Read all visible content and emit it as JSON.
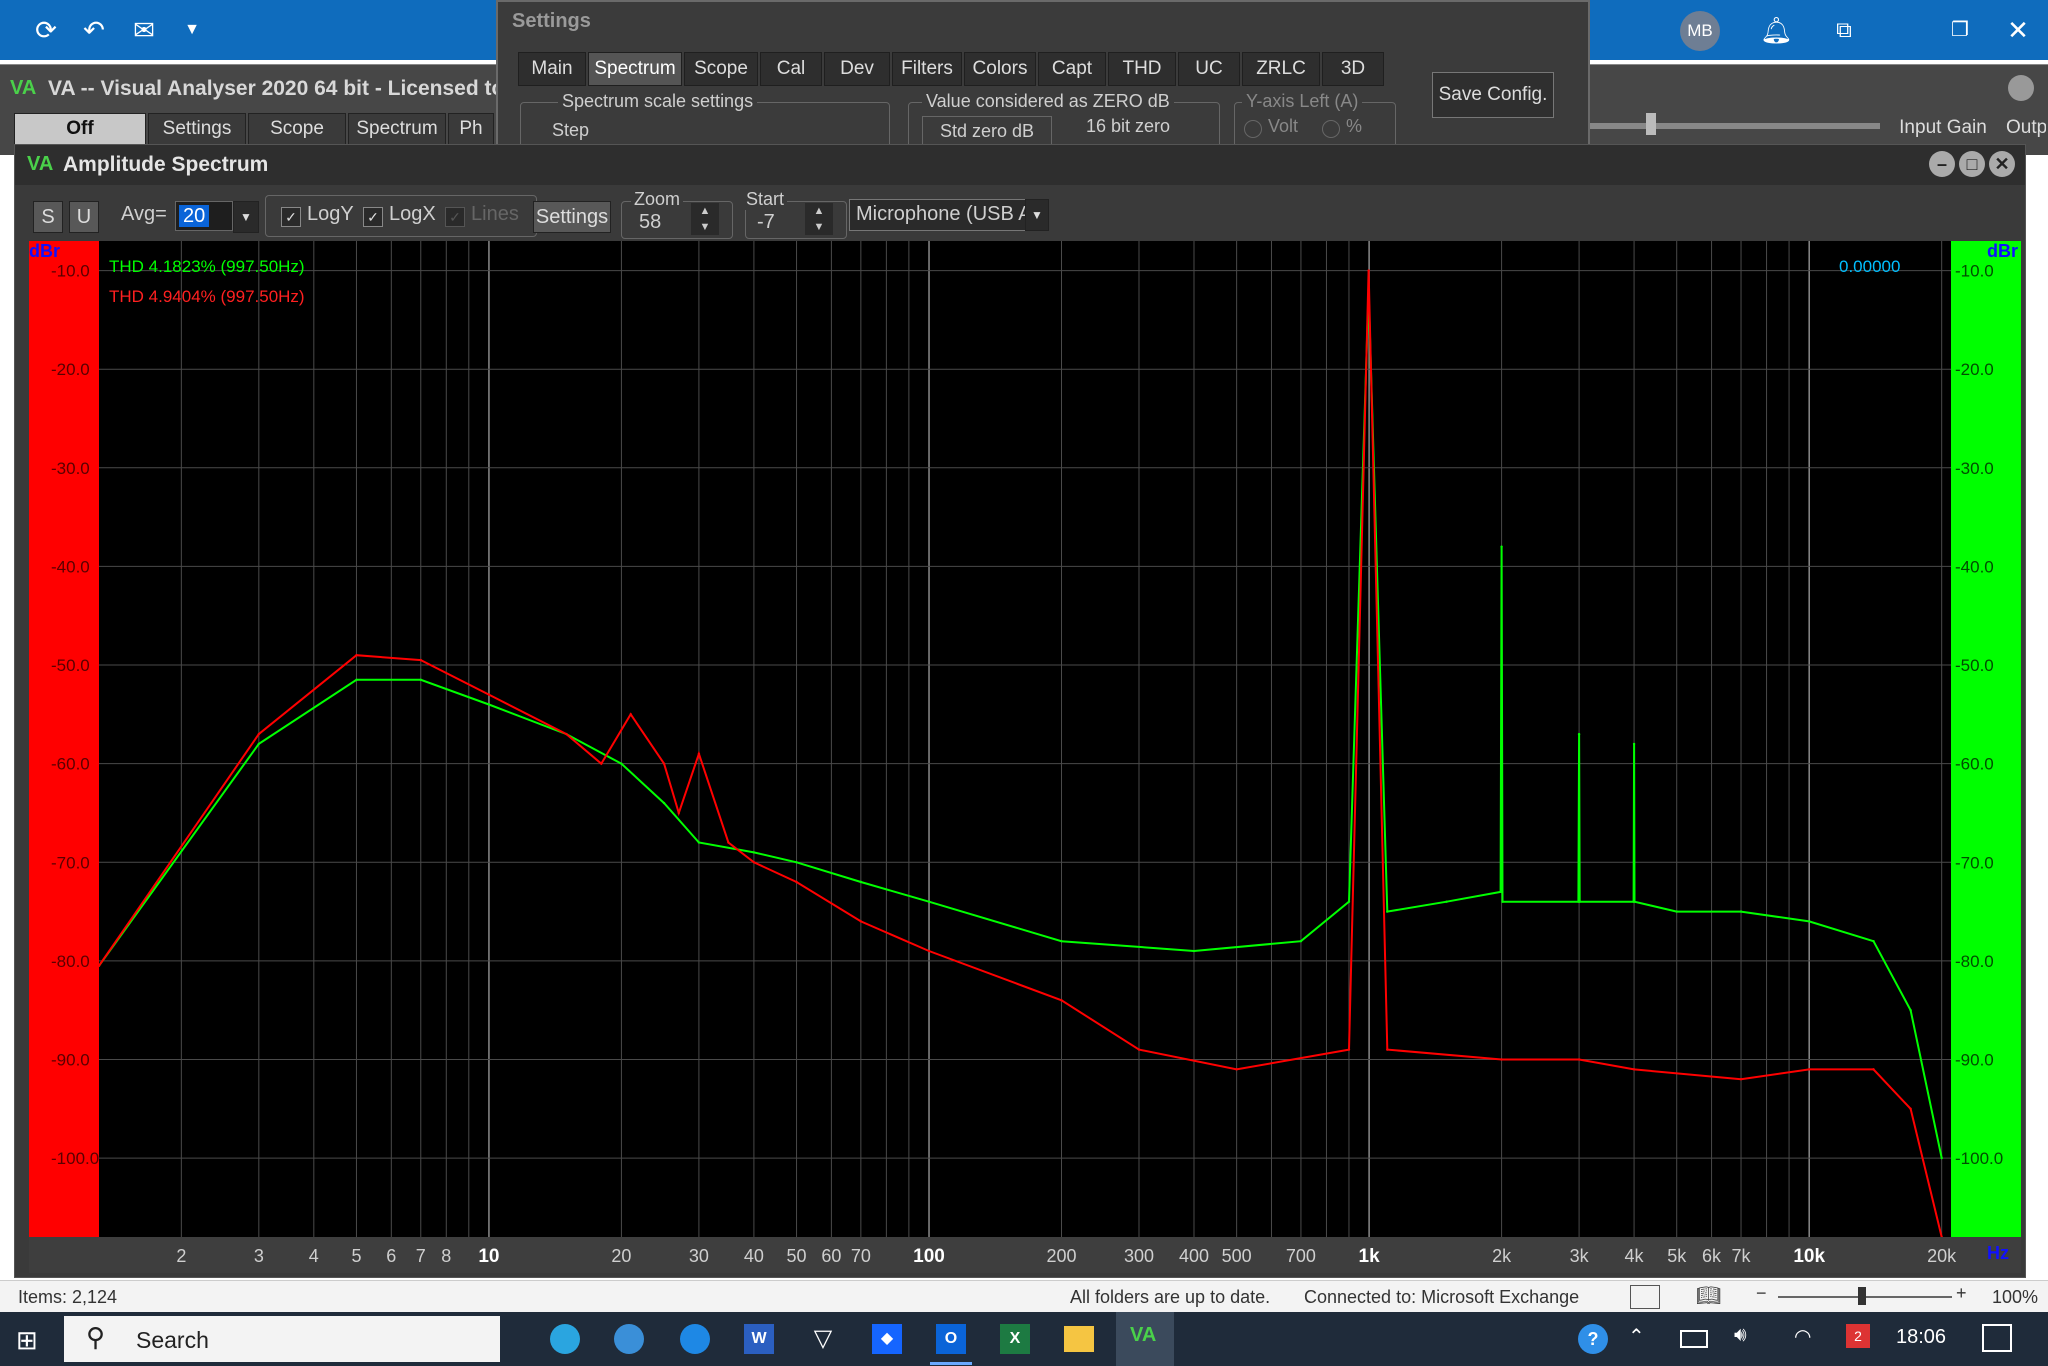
{
  "outlook": {
    "avatar": "MB",
    "icons": [
      "sync-icon",
      "undo-icon",
      "mail-icon",
      "chevron-down-icon",
      "bell-icon",
      "display-icon",
      "restore-icon",
      "close-icon"
    ]
  },
  "va_main": {
    "logo": "VA",
    "title": "VA -- Visual Analyser 2020 64 bit - Licensed to:",
    "buttons": [
      "Off",
      "Settings",
      "Scope",
      "Spectrum",
      "Ph"
    ],
    "right_label": "Input Gain",
    "right_label2": "Outp"
  },
  "settings": {
    "title": "Settings",
    "tabs": [
      "Main",
      "Spectrum",
      "Scope",
      "Cal",
      "Dev",
      "Filters",
      "Colors",
      "Capt",
      "THD",
      "UC",
      "ZRLC",
      "3D"
    ],
    "active_tab": "Spectrum",
    "group1_label": "Spectrum scale settings",
    "group1_item": "Step",
    "group2_label": "Value considered as ZERO dB",
    "group2_btn": "Std zero dB",
    "group2_value": "16 bit zero",
    "group3_label": "Y-axis Left (A)",
    "group3_opt1": "Volt",
    "group3_opt2": "%",
    "save_config": "Save Config."
  },
  "spectrum_window": {
    "logo": "VA",
    "title": "Amplitude Spectrum",
    "toolbar": {
      "s_btn": "S",
      "u_btn": "U",
      "avg_label": "Avg=",
      "avg_value": "20",
      "logy": "LogY",
      "logx": "LogX",
      "lines": "Lines",
      "settings": "Settings",
      "zoom_label": "Zoom",
      "zoom_value": "58",
      "start_label": "Start",
      "start_value": "-7",
      "device": "Microphone (USB A"
    },
    "unit_left": "dBr",
    "unit_right": "dBr",
    "unit_x": "Hz",
    "readout": "0.00000",
    "thd_green": "THD  4.1823% (997.50Hz)",
    "thd_red": "THD  4.9404% (997.50Hz)"
  },
  "chart_data": {
    "type": "line",
    "x_scale": "log",
    "xlim": [
      1.3,
      21000
    ],
    "ylim": [
      -108,
      -7
    ],
    "y_ticks": [
      -10.0,
      -20.0,
      -30.0,
      -40.0,
      -50.0,
      -60.0,
      -70.0,
      -80.0,
      -90.0,
      -100.0
    ],
    "y_tick_labels": [
      "-10.0",
      "-20.0",
      "-30.0",
      "-40.0",
      "-50.0",
      "-60.0",
      "-70.0",
      "-80.0",
      "-90.0",
      "-100.0"
    ],
    "x_ticks": [
      2,
      3,
      4,
      5,
      6,
      7,
      8,
      10,
      20,
      30,
      40,
      50,
      60,
      70,
      100,
      200,
      300,
      400,
      500,
      700,
      1000,
      2000,
      3000,
      4000,
      5000,
      6000,
      7000,
      10000,
      20000
    ],
    "x_tick_labels": [
      "2",
      "3",
      "4",
      "5",
      "6",
      "7",
      "8",
      "10",
      "20",
      "30",
      "40",
      "50",
      "60",
      "70",
      "100",
      "200",
      "300",
      "400",
      "500",
      "700",
      "1k",
      "2k",
      "3k",
      "4k",
      "5k",
      "6k",
      "7k",
      "10k",
      "20k"
    ],
    "x_tick_bold": [
      "10",
      "100",
      "1k",
      "10k"
    ],
    "grid": true,
    "series": [
      {
        "color": "#00ff00",
        "x": [
          1.3,
          3,
          5,
          7,
          10,
          15,
          20,
          25,
          30,
          40,
          50,
          70,
          100,
          200,
          400,
          700,
          900,
          997.5,
          1100,
          1500,
          1990,
          2000,
          2010,
          2990,
          3000,
          3010,
          3990,
          4000,
          4010,
          5000,
          7000,
          10000,
          14000,
          17000,
          20000
        ],
        "y": [
          -80.5,
          -58,
          -51.5,
          -51.5,
          -54,
          -57,
          -60,
          -64,
          -68,
          -69,
          -70,
          -72,
          -74,
          -78,
          -79,
          -78,
          -74,
          -12,
          -75,
          -74,
          -73,
          -38,
          -74,
          -74,
          -57,
          -74,
          -74,
          -58,
          -74,
          -75,
          -75,
          -76,
          -78,
          -85,
          -100
        ]
      },
      {
        "color": "#ff0000",
        "x": [
          1.3,
          3,
          5,
          7,
          10,
          15,
          18,
          21,
          25,
          27,
          30,
          35,
          40,
          50,
          70,
          100,
          200,
          300,
          500,
          900,
          997.5,
          1100,
          2000,
          3000,
          4000,
          7000,
          10000,
          14000,
          17000,
          20000
        ],
        "y": [
          -80.5,
          -57,
          -49,
          -49.5,
          -53,
          -57,
          -60,
          -55,
          -60,
          -65,
          -59,
          -68,
          -70,
          -72,
          -76,
          -79,
          -84,
          -89,
          -91,
          -89,
          -10,
          -89,
          -90,
          -90,
          -91,
          -92,
          -91,
          -91,
          -95,
          -108
        ]
      }
    ]
  },
  "status": {
    "items": "Items: 2,124",
    "sync": "All folders are up to date.",
    "connected": "Connected to: Microsoft Exchange",
    "zoom": "100%"
  },
  "taskbar": {
    "search": "Search",
    "time": "18:06",
    "badge": "2"
  }
}
